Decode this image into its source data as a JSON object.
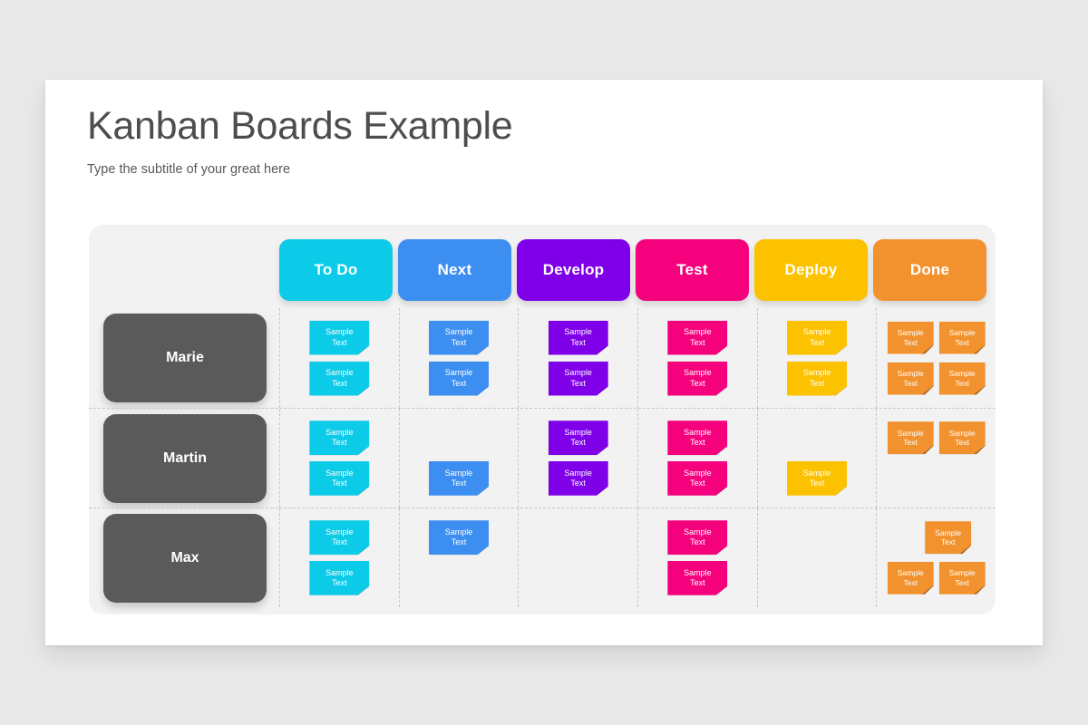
{
  "slide": {
    "title": "Kanban Boards Example",
    "subtitle": "Type the subtitle of your great here"
  },
  "note_text": {
    "line1": "Sample",
    "line2": "Text"
  },
  "colors": {
    "page_background": "#e9e9e9",
    "slide_background": "#ffffff",
    "board_background": "#f2f2f2",
    "person_chip": "#5a5a5a",
    "divider": "#c6c6c6",
    "title_text": "#4d4d4d",
    "subtitle_text": "#585858"
  },
  "columns": [
    {
      "label": "To Do",
      "color": "#0ccbe8",
      "note_size": "wide"
    },
    {
      "label": "Next",
      "color": "#3c8ef0",
      "note_size": "wide"
    },
    {
      "label": "Develop",
      "color": "#7f00e8",
      "note_size": "wide"
    },
    {
      "label": "Test",
      "color": "#f5007d",
      "note_size": "wide"
    },
    {
      "label": "Deploy",
      "color": "#fcc200",
      "note_size": "wide"
    },
    {
      "label": "Done",
      "color": "#f2922f",
      "note_size": "small"
    }
  ],
  "rows": [
    {
      "person": "Marie",
      "cells": [
        {
          "column": "To Do",
          "slots": [
            1,
            1
          ]
        },
        {
          "column": "Next",
          "slots": [
            1,
            1
          ]
        },
        {
          "column": "Develop",
          "slots": [
            1,
            1
          ]
        },
        {
          "column": "Test",
          "slots": [
            1,
            1
          ]
        },
        {
          "column": "Deploy",
          "slots": [
            1,
            1
          ]
        },
        {
          "column": "Done",
          "slots": [
            2,
            2
          ]
        }
      ]
    },
    {
      "person": "Martin",
      "cells": [
        {
          "column": "To Do",
          "slots": [
            1,
            1
          ]
        },
        {
          "column": "Next",
          "slots": [
            0,
            1
          ]
        },
        {
          "column": "Develop",
          "slots": [
            1,
            1
          ]
        },
        {
          "column": "Test",
          "slots": [
            1,
            1
          ]
        },
        {
          "column": "Deploy",
          "slots": [
            0,
            1
          ]
        },
        {
          "column": "Done",
          "slots": [
            2,
            0
          ]
        }
      ]
    },
    {
      "person": "Max",
      "cells": [
        {
          "column": "To Do",
          "slots": [
            1,
            1
          ]
        },
        {
          "column": "Next",
          "slots": [
            1,
            0
          ]
        },
        {
          "column": "Develop",
          "slots": [
            0,
            0
          ]
        },
        {
          "column": "Test",
          "slots": [
            1,
            1
          ]
        },
        {
          "column": "Deploy",
          "slots": [
            0,
            0
          ]
        },
        {
          "column": "Done",
          "slots": [
            1,
            2
          ],
          "top_offset": true
        }
      ]
    }
  ]
}
